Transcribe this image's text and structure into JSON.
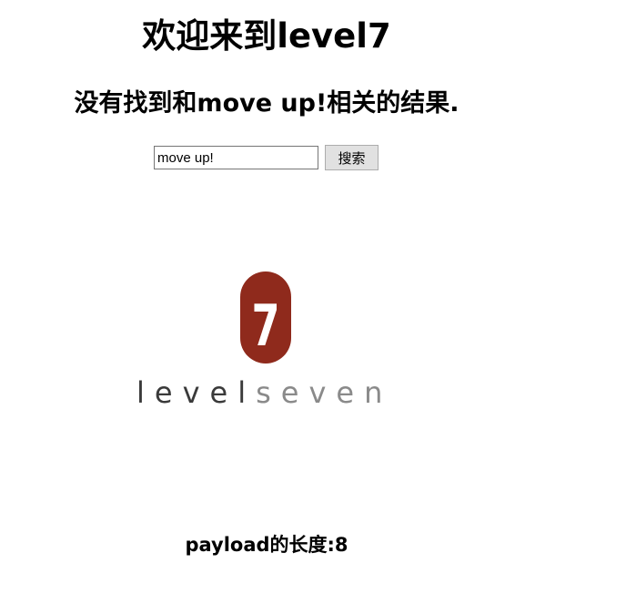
{
  "page": {
    "title": "欢迎来到level7",
    "result_message": "没有找到和move up!相关的结果.",
    "payload_length_text": "payload的长度:8"
  },
  "search": {
    "input_value": "move up!",
    "button_label": "搜索"
  },
  "logo": {
    "badge_text": "7",
    "word_dark": "level",
    "word_light": "seven",
    "badge_color": "#8f2a1c",
    "dark_text_color": "#3a3a3a",
    "light_text_color": "#8a8a8a"
  }
}
